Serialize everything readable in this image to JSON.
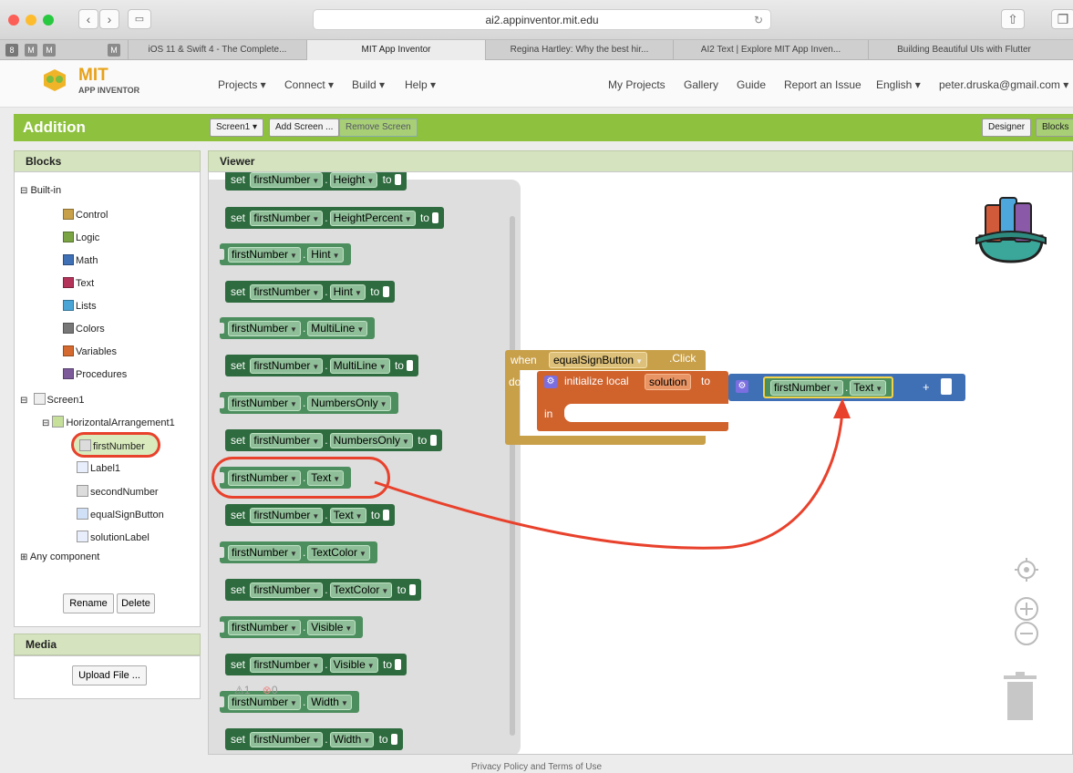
{
  "browser": {
    "url": "ai2.appinventor.mit.edu",
    "tabs": [
      "iOS 11 & Swift 4 - The Complete...",
      "MIT App Inventor",
      "Regina Hartley: Why the best hir...",
      "AI2 Text | Explore MIT App Inven...",
      "Building Beautiful UIs with Flutter"
    ],
    "pinned": [
      "8",
      "M",
      "M",
      "M"
    ],
    "active_tab": 1
  },
  "logo": {
    "line1": "MIT",
    "line2": "APP INVENTOR"
  },
  "nav": {
    "projects": "Projects ▾",
    "connect": "Connect ▾",
    "build": "Build ▾",
    "help": "Help ▾",
    "my_projects": "My Projects",
    "gallery": "Gallery",
    "guide": "Guide",
    "report": "Report an Issue",
    "language": "English ▾",
    "user": "peter.druska@gmail.com ▾"
  },
  "project": {
    "title": "Addition",
    "screen_select": "Screen1 ▾",
    "add_screen": "Add Screen ...",
    "remove_screen": "Remove Screen",
    "designer": "Designer",
    "blocks": "Blocks"
  },
  "panels": {
    "blocks_title": "Blocks",
    "viewer_title": "Viewer",
    "media_title": "Media",
    "upload": "Upload File ...",
    "rename": "Rename",
    "delete": "Delete"
  },
  "tree": {
    "builtin": "Built-in",
    "builtins": [
      {
        "label": "Control",
        "color": "#c8a04a"
      },
      {
        "label": "Logic",
        "color": "#7aa443"
      },
      {
        "label": "Math",
        "color": "#3f6fb5"
      },
      {
        "label": "Text",
        "color": "#b3335a"
      },
      {
        "label": "Lists",
        "color": "#4aa5d6"
      },
      {
        "label": "Colors",
        "color": "#777777"
      },
      {
        "label": "Variables",
        "color": "#d46a2f"
      },
      {
        "label": "Procedures",
        "color": "#7d5b9b"
      }
    ],
    "screen": "Screen1",
    "arrangement": "HorizontalArrangement1",
    "components": [
      "firstNumber",
      "Label1",
      "secondNumber",
      "equalSignButton",
      "solutionLabel"
    ],
    "any": "Any component"
  },
  "flyout": {
    "comp": "firstNumber",
    "set": "set",
    "to": "to",
    "dot": ".",
    "blocks": [
      {
        "kind": "set",
        "prop": "Height"
      },
      {
        "kind": "set",
        "prop": "HeightPercent"
      },
      {
        "kind": "get",
        "prop": "Hint"
      },
      {
        "kind": "set",
        "prop": "Hint"
      },
      {
        "kind": "get",
        "prop": "MultiLine"
      },
      {
        "kind": "set",
        "prop": "MultiLine"
      },
      {
        "kind": "get",
        "prop": "NumbersOnly"
      },
      {
        "kind": "set",
        "prop": "NumbersOnly"
      },
      {
        "kind": "get",
        "prop": "Text"
      },
      {
        "kind": "set",
        "prop": "Text"
      },
      {
        "kind": "get",
        "prop": "TextColor"
      },
      {
        "kind": "set",
        "prop": "TextColor"
      },
      {
        "kind": "get",
        "prop": "Visible"
      },
      {
        "kind": "set",
        "prop": "Visible"
      },
      {
        "kind": "get",
        "prop": "Width"
      },
      {
        "kind": "set",
        "prop": "Width"
      }
    ]
  },
  "workspace": {
    "when": "when",
    "component": "equalSignButton",
    "event": ".Click",
    "do": "do",
    "init": "initialize local",
    "var": "solution",
    "to": "to",
    "in": "in",
    "comp": "firstNumber",
    "dot": ".",
    "prop": "Text",
    "plus": "+"
  },
  "warnings": {
    "warn": "1",
    "err": "0"
  },
  "footer": "Privacy Policy and Terms of Use"
}
